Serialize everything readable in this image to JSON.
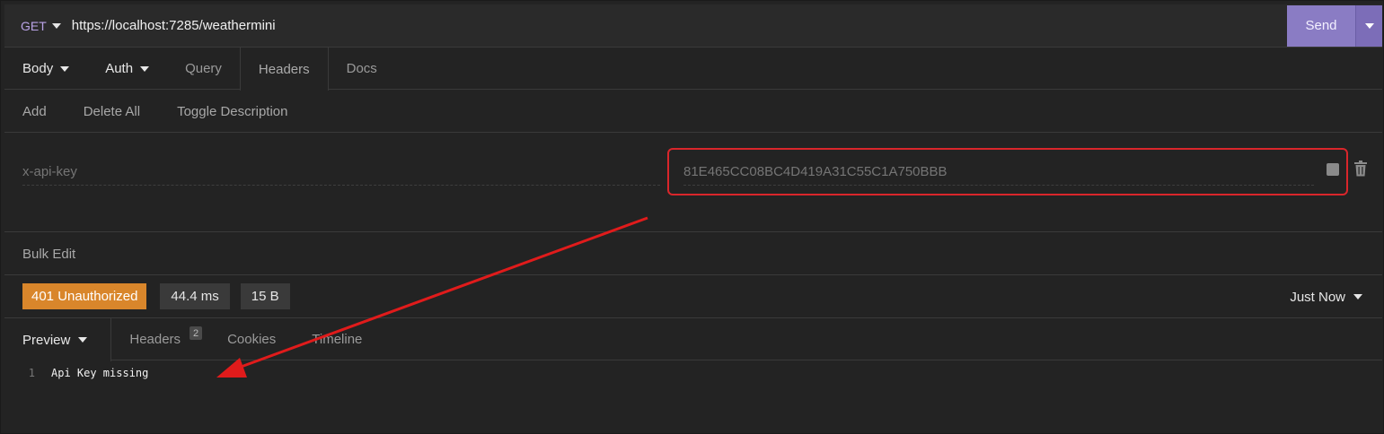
{
  "request": {
    "method": "GET",
    "url": "https://localhost:7285/weathermini",
    "send_label": "Send"
  },
  "request_tabs": [
    {
      "label": "Body"
    },
    {
      "label": "Auth"
    },
    {
      "label": "Query"
    },
    {
      "label": "Headers"
    },
    {
      "label": "Docs"
    }
  ],
  "header_actions": {
    "add": "Add",
    "delete_all": "Delete All",
    "toggle_description": "Toggle Description"
  },
  "header_row": {
    "name_placeholder": "x-api-key",
    "value_placeholder": "81E465CC08BC4D419A31C55C1A750BBB"
  },
  "bulk_edit": "Bulk Edit",
  "response": {
    "status": "401 Unauthorized",
    "time": "44.4 ms",
    "size": "15 B",
    "when": "Just Now"
  },
  "response_tabs": [
    {
      "label": "Preview"
    },
    {
      "label": "Headers",
      "badge": "2"
    },
    {
      "label": "Cookies"
    },
    {
      "label": "Timeline"
    }
  ],
  "response_body": {
    "line_number": "1",
    "text": "Api Key missing"
  },
  "colors": {
    "send": "#8a7cc4",
    "status_401": "#d9862b",
    "highlight": "#d9262b",
    "method": "#b9a3e6"
  }
}
